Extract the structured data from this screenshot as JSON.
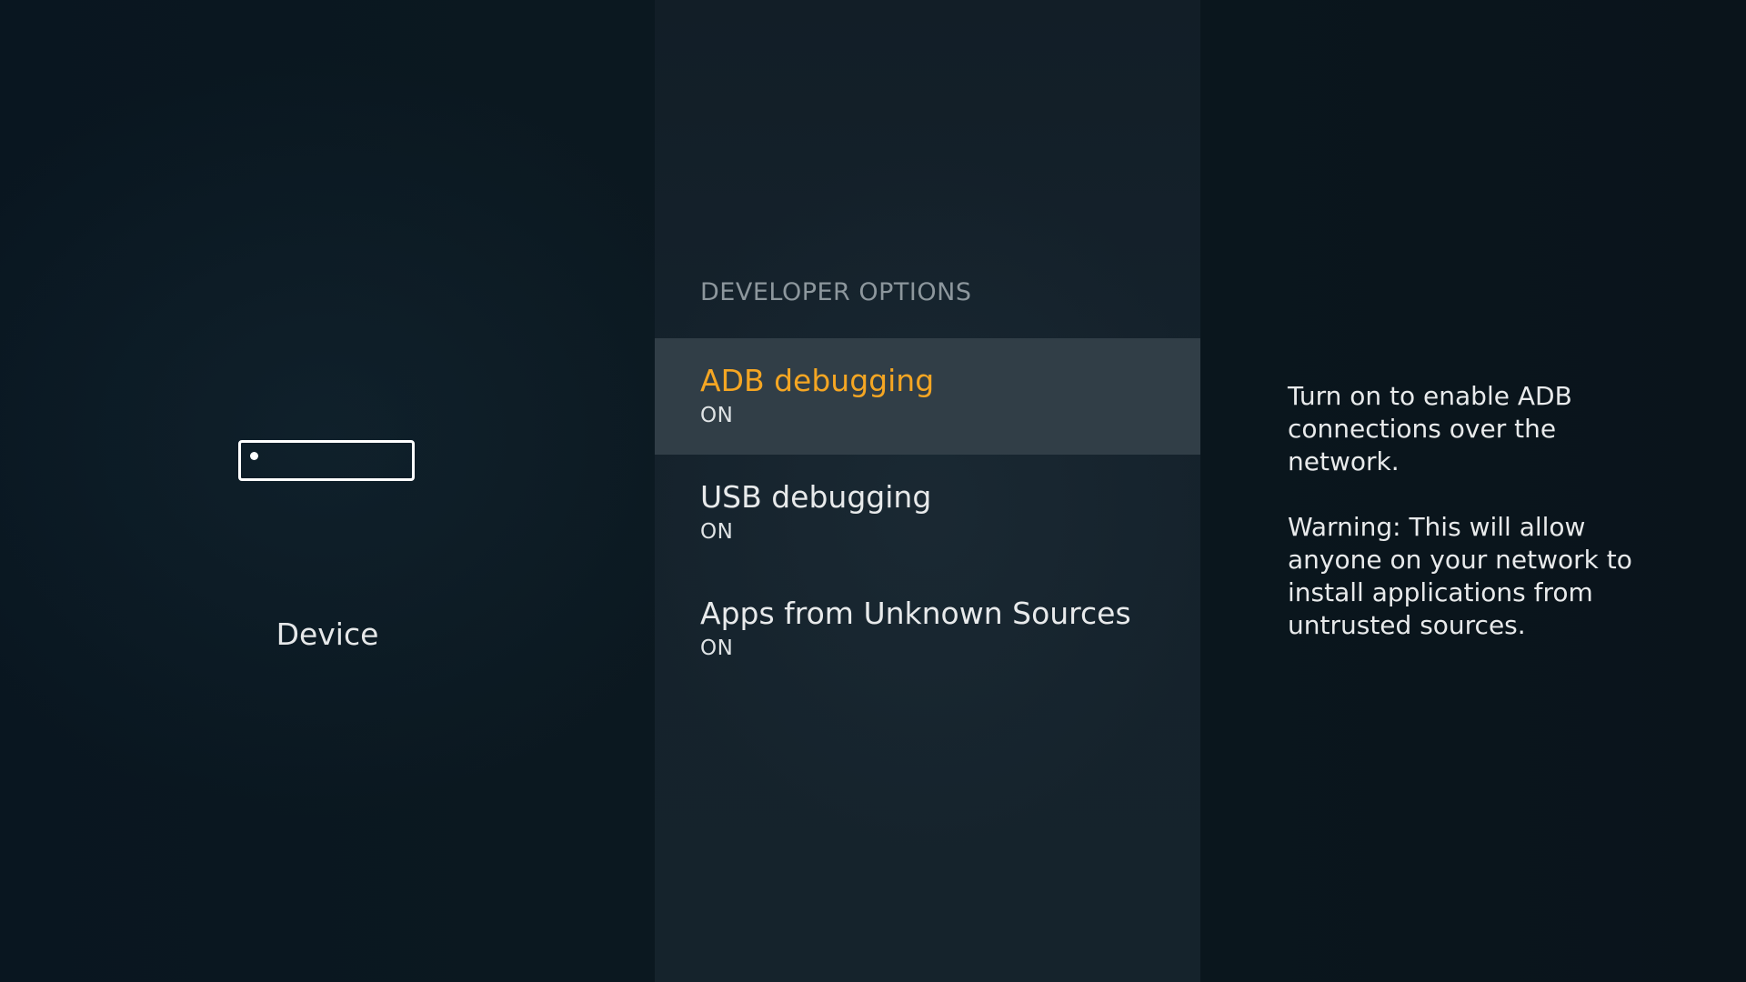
{
  "left": {
    "icon": "fire-tv-device-icon",
    "label": "Device"
  },
  "middle": {
    "section_title": "DEVELOPER OPTIONS",
    "items": [
      {
        "label": "ADB debugging",
        "value": "ON",
        "focused": true
      },
      {
        "label": "USB debugging",
        "value": "ON",
        "focused": false
      },
      {
        "label": "Apps from Unknown Sources",
        "value": "ON",
        "focused": false
      }
    ]
  },
  "right": {
    "description_1": "Turn on to enable ADB connections over the network.",
    "description_2": "Warning: This will allow anyone on your network to install applications from untrusted sources."
  },
  "colors": {
    "focus_text": "#f5a623",
    "focus_background": "#313e47",
    "background": "#0b151c"
  }
}
